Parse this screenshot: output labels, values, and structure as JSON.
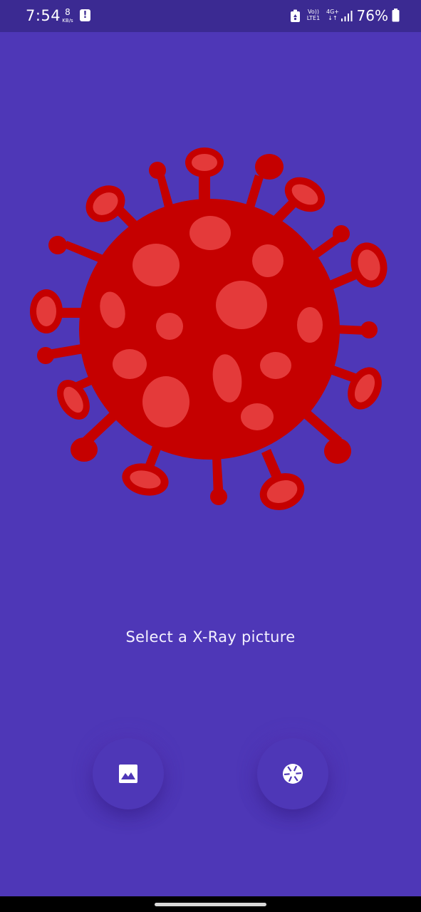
{
  "status_bar": {
    "time": "7:54",
    "net_speed_value": "8",
    "net_speed_unit": "KB/s",
    "volte_top": "Vo))",
    "volte_bottom": "LTE1",
    "network_top": "4G+",
    "network_bottom": "↓↑",
    "battery_percent": "76%"
  },
  "main": {
    "caption": "Select a X-Ray picture"
  },
  "icons": {
    "gallery": "image-icon",
    "camera": "camera-shutter-icon",
    "illustration": "virus-illustration"
  },
  "colors": {
    "background": "#4e37b7",
    "status_bar": "#3b2a92",
    "virus_dark": "#c50000",
    "virus_light": "#e43a3a"
  }
}
